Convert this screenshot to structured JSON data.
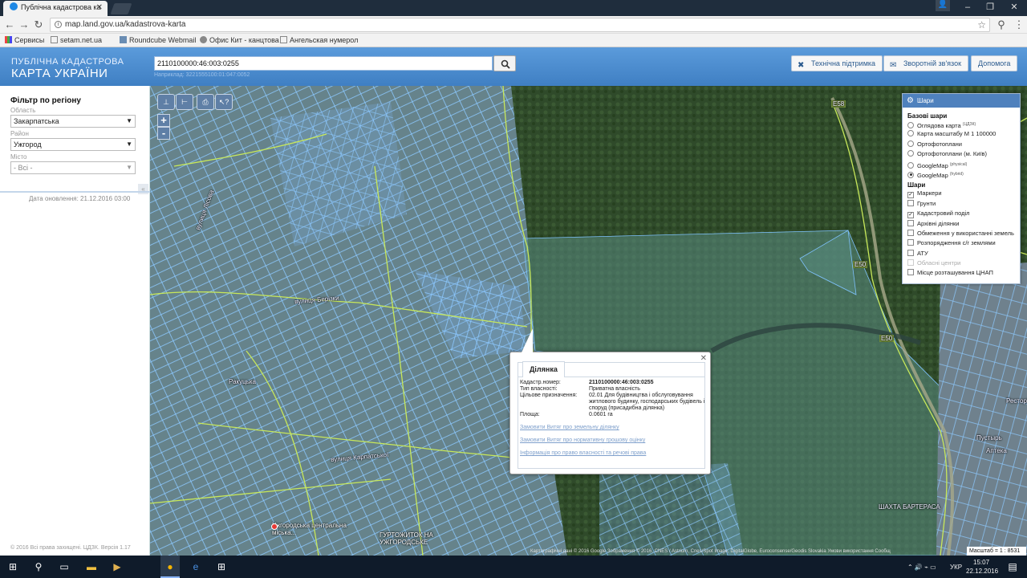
{
  "browser": {
    "tab_title": "Публічна кадастрова ка",
    "url": "map.land.gov.ua/kadastrova-karta",
    "bookmarks": [
      "Сервисы",
      "setam.net.ua",
      "Roundcube Webmail",
      "Офис Кит - канцтова",
      "Ангельская нумерол"
    ]
  },
  "header": {
    "brand_line1": "ПУБЛІЧНА КАДАСТРОВА",
    "brand_line2": "КАРТА УКРАЇНИ",
    "search_value": "2110100000:46:003:0255",
    "search_hint": "Наприклад: 3221555100:01:047:0052",
    "buttons": [
      "Технічна підтримка",
      "Зворотній зв'язок",
      "Допомога"
    ]
  },
  "filter": {
    "title": "Фільтр по регіону",
    "region_label": "Область",
    "region_value": "Закарпатська",
    "district_label": "Район",
    "district_value": "Ужгород",
    "city_label": "Місто",
    "city_value": "- Всі -",
    "updated": "Дата оновлення: 21.12.2016 03:00",
    "copyright": "© 2016 Всі права захищені. ЦДЗК. Версія 1.17"
  },
  "map_tools": [
    "⊥",
    "⊢",
    "⎙",
    "↖?"
  ],
  "zoom": {
    "in": "+",
    "out": "-"
  },
  "layers": {
    "title": "Шари",
    "base_title": "Базові шари",
    "base": [
      {
        "label": "Оглядова карта",
        "sup": "(ЦДЗК)",
        "on": false
      },
      {
        "label": "Карта масштабу М 1 100000",
        "sup": "",
        "on": false
      },
      {
        "label": "Ортофотоплани",
        "sup": "",
        "on": false
      },
      {
        "label": "Ортофотоплани (м. Київ)",
        "sup": "",
        "on": false
      },
      {
        "label": "GoogleMap",
        "sup": "(physical)",
        "on": false
      },
      {
        "label": "GoogleMap",
        "sup": "(hybrid)",
        "on": true
      }
    ],
    "layers_title": "Шари",
    "items": [
      {
        "label": "Маркери",
        "checked": true
      },
      {
        "label": "Грунти",
        "checked": false
      },
      {
        "label": "Кадастровий поділ",
        "checked": true
      },
      {
        "label": "Архівні ділянки",
        "checked": false
      },
      {
        "label": "Обмеження у використанні земель",
        "checked": false
      },
      {
        "label": "Розпорядження с/г землями",
        "checked": false
      },
      {
        "label": "АТУ",
        "checked": false
      },
      {
        "label": "Обласні центри",
        "checked": false,
        "disabled": true
      },
      {
        "label": "Місце розташування ЦНАП",
        "checked": false
      }
    ]
  },
  "popup": {
    "tab": "Ділянка",
    "rows": [
      {
        "label": "Кадастр.номер:",
        "value": "2110100000:46:003:0255"
      },
      {
        "label": "Тип власності:",
        "value": "Приватна власність"
      },
      {
        "label": "Цільове призначення:",
        "value": "02.01 Для будівництва і обслуговування житлового будинку, господарських будівель і споруд (присадибна ділянка)"
      },
      {
        "label": "Площа:",
        "value": "0.0601 га"
      }
    ],
    "links": [
      "Замовити Витяг про земельну ділянку",
      "Замовити Витяг про нормативну грошову оцінку",
      "Інформація про право власності та речові права"
    ]
  },
  "map_labels": {
    "street1": "вулиця Лісова",
    "street2": "вулиця Берізки",
    "street3": "вулиця Карпатської",
    "district": "Ракуцька",
    "poi1": "Ужгородська центральна міська...",
    "poi2": "ГУРТОЖИТОК НА УЖГОРОДСЬКЕ",
    "mine": "ШАХТА БАРТЕРАСА",
    "e50a": "E50",
    "e50b": "E50",
    "e58": "E58",
    "rest": "Ресторі",
    "pustyr": "Пустырь",
    "apteka": "Аптека",
    "attrib": "Картографічні дані © 2016 Google Зображення © 2016, CNES / Astrium, Cnes/Spot Image, DigitalGlobe, Euroconsense/Geodis Slovakia   Умови використання   Сообщ",
    "scale": "Масштаб = 1 : 8531"
  },
  "taskbar": {
    "lang": "УКР",
    "time": "15:07",
    "date": "22.12.2016"
  },
  "colors": {
    "header_blue": "#4f8ed0",
    "parcel_outline": "#7fc3ff",
    "road_outline": "#c8e85a"
  }
}
